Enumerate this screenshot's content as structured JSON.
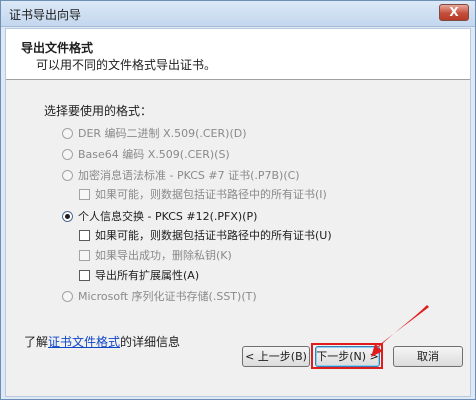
{
  "window": {
    "title": "证书导出向导",
    "close_glyph": "X"
  },
  "header": {
    "title": "导出文件格式",
    "subtitle": "可以用不同的文件格式导出证书。"
  },
  "format_section": {
    "label": "选择要使用的格式：",
    "options": [
      {
        "label": "DER 编码二进制 X.509(.CER)(D)",
        "enabled": false,
        "checked": false
      },
      {
        "label": "Base64 编码 X.509(.CER)(S)",
        "enabled": false,
        "checked": false
      },
      {
        "label": "加密消息语法标准 - PKCS #7 证书(.P7B)(C)",
        "enabled": false,
        "checked": false
      },
      {
        "label": "个人信息交换 - PKCS #12(.PFX)(P)",
        "enabled": true,
        "checked": true
      },
      {
        "label": "Microsoft 序列化证书存储(.SST)(T)",
        "enabled": false,
        "checked": false
      }
    ],
    "p7b_checkbox": {
      "label": "如果可能，则数据包括证书路径中的所有证书(I)",
      "enabled": false,
      "checked": false
    },
    "pfx_checkboxes": [
      {
        "label": "如果可能，则数据包括证书路径中的所有证书(U)",
        "enabled": true,
        "checked": false
      },
      {
        "label": "如果导出成功，删除私钥(K)",
        "enabled": false,
        "checked": false
      },
      {
        "label": "导出所有扩展属性(A)",
        "enabled": true,
        "checked": false
      }
    ]
  },
  "footer": {
    "prefix": "了解",
    "link": "证书文件格式",
    "suffix": "的详细信息"
  },
  "buttons": {
    "back": "< 上一步(B)",
    "next": "下一步(N) >",
    "cancel": "取消"
  },
  "annotation": {
    "highlight_color": "#e11c1c"
  }
}
